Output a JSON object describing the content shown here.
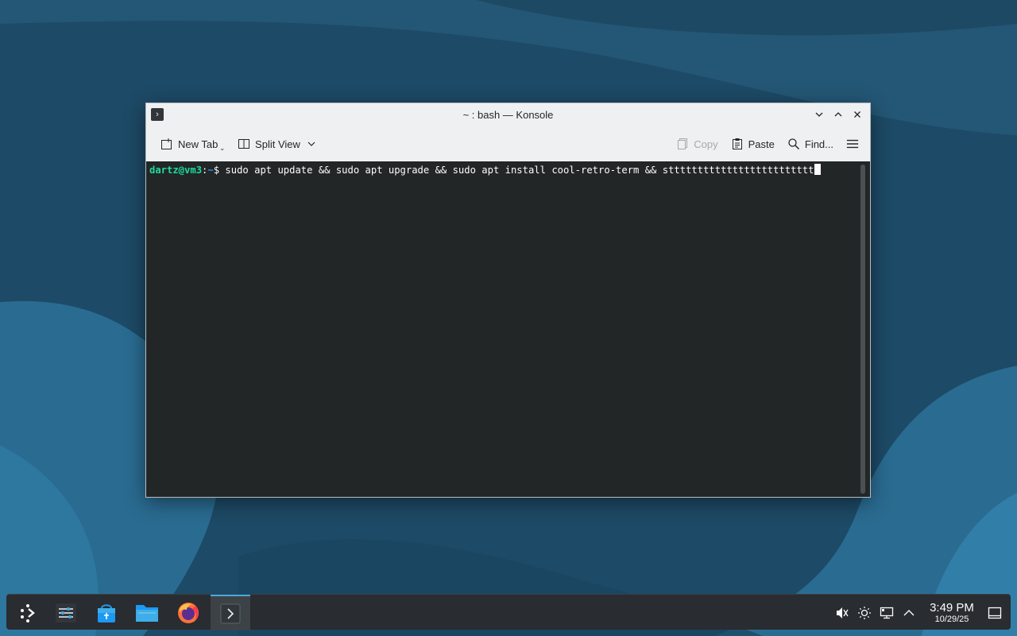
{
  "window": {
    "title": "~ : bash — Konsole",
    "controls": {
      "minimize": "⌄",
      "maximize": "⌃",
      "close": "✕"
    }
  },
  "toolbar": {
    "new_tab": "New Tab",
    "split_view": "Split View",
    "copy": "Copy",
    "paste": "Paste",
    "find": "Find..."
  },
  "terminal": {
    "prompt_user": "dartz@vm3",
    "prompt_sep": ":",
    "prompt_path": "~",
    "prompt_symbol": "$ ",
    "command": "sudo apt update && sudo apt upgrade && sudo apt install cool-retro-term && sttttttttttttttttttttttttt"
  },
  "taskbar": {
    "apps": [
      "application-launcher-icon",
      "system-settings-icon",
      "discover-store-icon",
      "file-manager-icon",
      "firefox-icon",
      "konsole-icon"
    ],
    "tray": [
      "volume-muted-icon",
      "brightness-icon",
      "network-icon",
      "show-hidden-icon"
    ],
    "clock": {
      "time": "3:49 PM",
      "date": "10/29/25"
    }
  },
  "colors": {
    "accent": "#3daee9",
    "prompt_user": "#1cdc9a",
    "prompt_path": "#1d99f3",
    "terminal_bg": "#232627"
  }
}
